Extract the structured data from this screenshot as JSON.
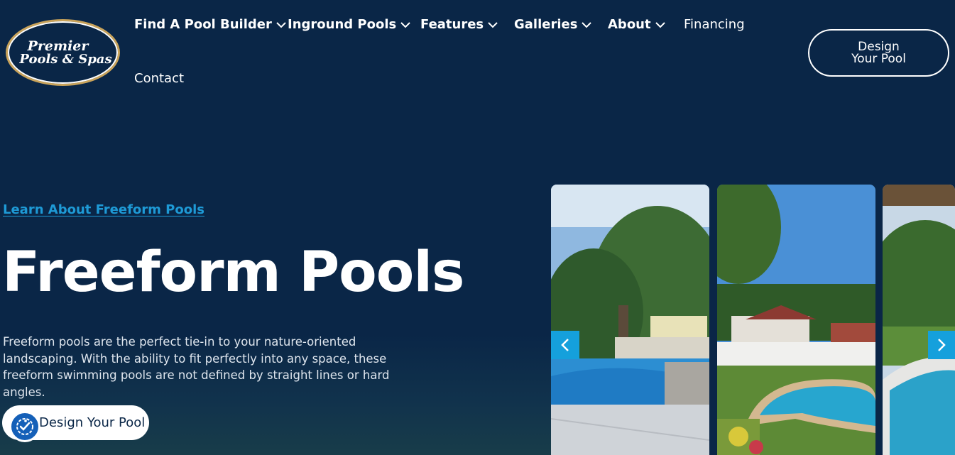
{
  "logo": {
    "line1": "Premier",
    "line2": "Pools & Spas"
  },
  "nav": {
    "items": [
      {
        "label": "Find A Pool Builder",
        "dropdown": true
      },
      {
        "label": "Inground Pools",
        "dropdown": true
      },
      {
        "label": "Features",
        "dropdown": true
      },
      {
        "label": "Galleries",
        "dropdown": true
      },
      {
        "label": "About",
        "dropdown": true
      },
      {
        "label": "Financing",
        "dropdown": false
      },
      {
        "label": "Contact",
        "dropdown": false
      }
    ]
  },
  "header_button": {
    "line1": "Design",
    "line2": "Your Pool"
  },
  "hero": {
    "link": "Learn About Freeform Pools",
    "title": "Freeform Pools",
    "description": "Freeform pools are the perfect tie-in to your nature-oriented landscaping. With the ability to fit perfectly into any space, these freeform swimming pools are not defined by straight lines or hard angles.",
    "cta": "Design Your Pool"
  },
  "icons": {
    "chevron": "chevron-down-icon",
    "prev": "chevron-left-icon",
    "next": "chevron-right-icon",
    "accessibility": "accessibility-icon"
  },
  "colors": {
    "background": "#0a2647",
    "accent": "#1e9ad6",
    "logo_ring": "#c9a35a",
    "arrow": "#15a0dc"
  }
}
